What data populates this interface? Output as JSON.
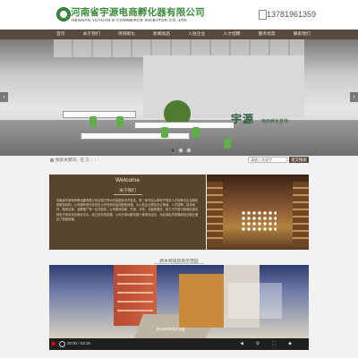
{
  "header": {
    "logo_cn": "河南省宇源电商孵化器有限公司",
    "logo_en": "HENNAN YUYUAN E-COMMERCE INCBATOR CO.,LTD",
    "phone": "13781961359"
  },
  "nav": {
    "items": [
      "首页",
      "关于我们",
      "项目孵化",
      "新闻动态",
      "入驻企业",
      "人才招聘",
      "服务优势",
      "联系我们"
    ]
  },
  "hero": {
    "brand": "宇源",
    "subtitle": "电商孵化基地",
    "active_slide": 1,
    "slide_count": 3
  },
  "search": {
    "hot_label": "搜索关键词：在 方 ：: ：",
    "placeholder": "请输入关键字",
    "button": "提交搜索"
  },
  "welcome": {
    "title": "Welcome",
    "subtitle": "关于我们",
    "text": "河南省宇源电商孵化器有限公司坐落于郑州市高新技术开发区，是一家专业从事电子商务人才培养与企业孵化的服务机构。公司拥有现代化的办公环境和完善的配套设施，为入驻企业提供办公场地、人才招聘、技术培训、融资对接、品牌推广等一站式服务。公司秉承创新、开放、共享、共赢的理念，致力于打造中原地区领先的电子商务创业孵化平台。经过多年的发展，公司已成功孵化数十家电商企业，为区域经济发展和创业就业做出了积极贡献。"
  },
  "photo": {
    "banner": "河南省宇源电商孵化器有限公司"
  },
  "video": {
    "section_title": "新乡跨境贸易示范园",
    "caption": "新乡跨境贸易示范园",
    "time": "00:00 / 03:19"
  },
  "colors": {
    "brand_green": "#3c8a3c",
    "nav_brown": "#574a3c",
    "welcome_bg": "#57462d"
  }
}
